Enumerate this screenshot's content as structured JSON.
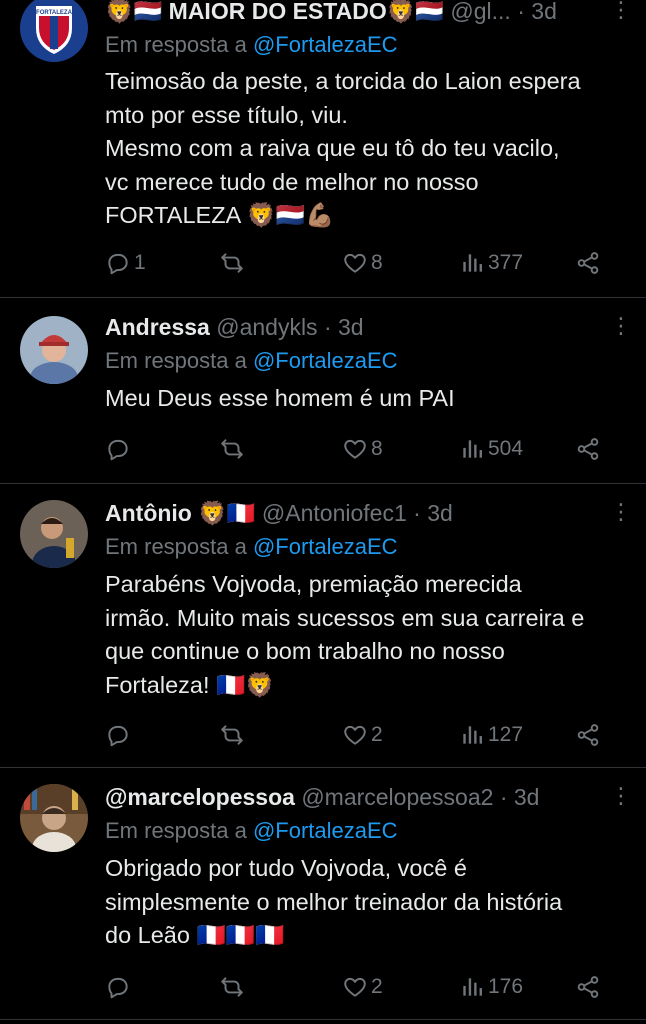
{
  "tweets": [
    {
      "name": "🦁🇳🇱 MAIOR DO ESTADO🦁🇳🇱",
      "handle": "@gl...",
      "time": "3d",
      "reply_label": "Em resposta a",
      "reply_to": "@FortalezaEC",
      "lines": [
        "Teimosão da peste, a torcida do Laion espera",
        "mto por esse título, viu.",
        "Mesmo com a raiva que eu tô do teu vacilo,",
        "vc merece tudo de melhor no nosso",
        "FORTALEZA 🦁🇳🇱💪🏽"
      ],
      "replies": "1",
      "retweets": "",
      "likes": "8",
      "views": "377",
      "avatar": {
        "type": "crest",
        "label": "FORTALEZA"
      }
    },
    {
      "name": "Andressa",
      "handle": "@andykls",
      "time": "3d",
      "reply_label": "Em resposta a",
      "reply_to": "@FortalezaEC",
      "lines": [
        "Meu Deus esse homem é um PAI"
      ],
      "replies": "",
      "retweets": "",
      "likes": "8",
      "views": "504",
      "avatar": {
        "type": "photo",
        "bg": "#8aa0b5",
        "fg": "#c23b3b"
      }
    },
    {
      "name": "Antônio 🦁🇫🇷",
      "handle": "@Antoniofec1",
      "time": "3d",
      "reply_label": "Em resposta a",
      "reply_to": "@FortalezaEC",
      "lines": [
        "Parabéns Vojvoda, premiação merecida",
        "irmão. Muito mais sucessos em sua carreira e",
        "que continue o bom trabalho no nosso",
        "Fortaleza! 🇫🇷🦁"
      ],
      "replies": "",
      "retweets": "",
      "likes": "2",
      "views": "127",
      "avatar": {
        "type": "photo",
        "bg": "#6b6156",
        "fg": "#1a2a4a"
      }
    },
    {
      "name": "@marcelopessoa",
      "handle": "@marcelopessoa2",
      "time": "3d",
      "reply_label": "Em resposta a",
      "reply_to": "@FortalezaEC",
      "lines": [
        "Obrigado por tudo Vojvoda, você é",
        "simplesmente o melhor treinador da história",
        "do Leão 🇫🇷🇫🇷🇫🇷"
      ],
      "replies": "",
      "retweets": "",
      "likes": "2",
      "views": "176",
      "avatar": {
        "type": "photo",
        "bg": "#7a5a3c",
        "fg": "#e8e2d8"
      }
    }
  ]
}
